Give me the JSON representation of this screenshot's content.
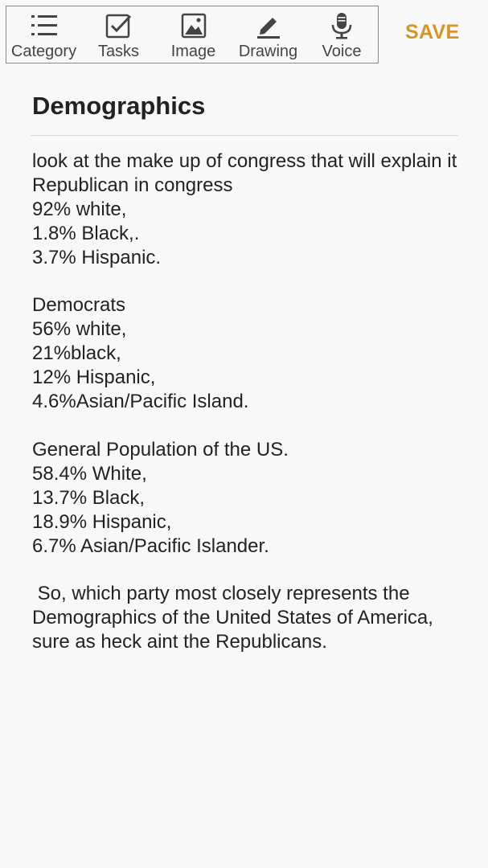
{
  "toolbar": {
    "items": [
      {
        "label": "Category",
        "icon": "list-icon"
      },
      {
        "label": "Tasks",
        "icon": "checkbox-icon"
      },
      {
        "label": "Image",
        "icon": "image-icon"
      },
      {
        "label": "Drawing",
        "icon": "pen-icon"
      },
      {
        "label": "Voice",
        "icon": "microphone-icon"
      }
    ],
    "save_label": "SAVE"
  },
  "colors": {
    "accent": "#d4962a",
    "background": "#f8f8f8",
    "icon": "#444444"
  },
  "note": {
    "title": "Demographics",
    "body": "look at the make up of congress that will explain it\nRepublican in congress\n92% white,\n1.8% Black,.\n3.7% Hispanic.\n\nDemocrats\n56% white,\n21%black,\n12% Hispanic,\n4.6%Asian/Pacific Island.\n\nGeneral Population of the US.\n58.4% White,\n13.7% Black,\n18.9% Hispanic,\n6.7% Asian/Pacific Islander.\n\n So, which party most closely represents the Demographics of the United States of America, sure as heck aint the Republicans."
  }
}
